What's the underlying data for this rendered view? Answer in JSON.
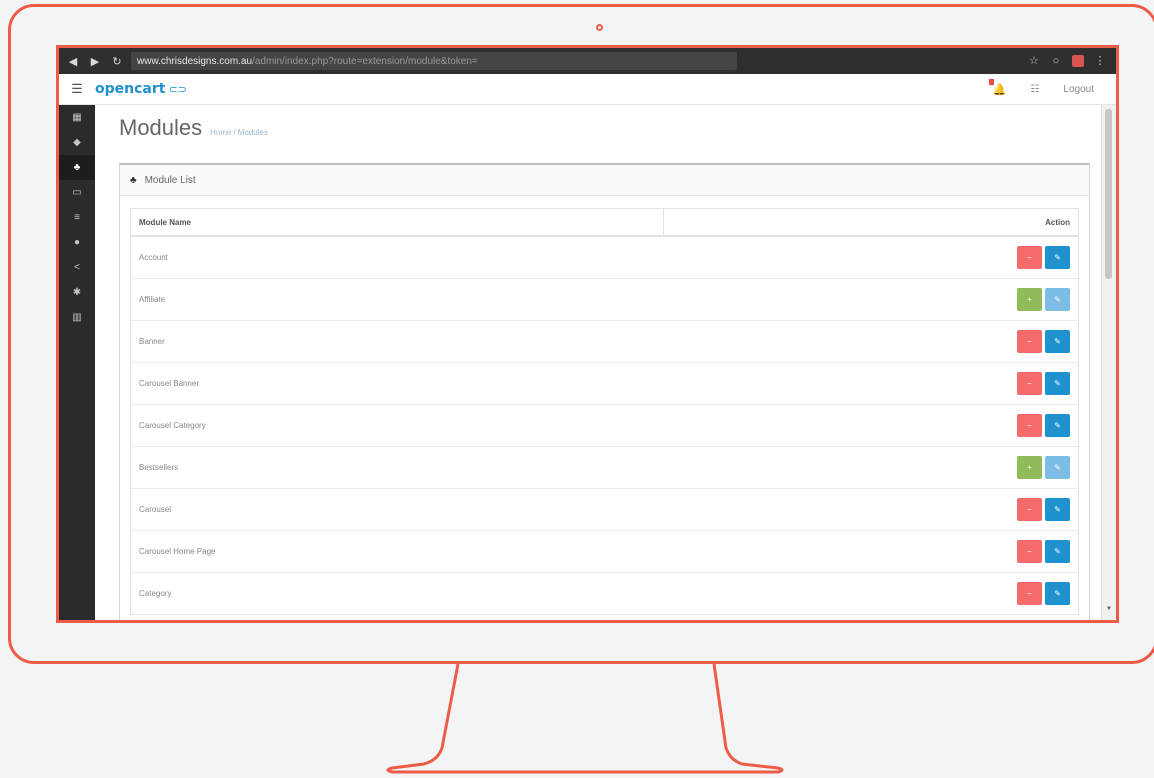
{
  "browser": {
    "url_host": "www.chrisdesigns.com.au",
    "url_path": "/admin/index.php?route=extension/module&token=",
    "icons": [
      "back-arrow-icon",
      "forward-arrow-icon",
      "reload-icon",
      "star-icon",
      "refresh-icon",
      "extension-icon",
      "menu-dots-icon"
    ]
  },
  "header": {
    "logo": "opencart",
    "logout_label": "Logout"
  },
  "sidebar": {
    "items": [
      {
        "icon": "dashboard-icon",
        "glyph": "▦",
        "active": false
      },
      {
        "icon": "catalog-icon",
        "glyph": "◆",
        "active": false
      },
      {
        "icon": "extensions-icon",
        "glyph": "♣",
        "active": true
      },
      {
        "icon": "design-icon",
        "glyph": "▭",
        "active": false
      },
      {
        "icon": "sales-icon",
        "glyph": "≡",
        "active": false
      },
      {
        "icon": "customers-icon",
        "glyph": "●",
        "active": false
      },
      {
        "icon": "marketing-icon",
        "glyph": "<",
        "active": false
      },
      {
        "icon": "system-icon",
        "glyph": "✱",
        "active": false
      },
      {
        "icon": "reports-icon",
        "glyph": "▥",
        "active": false
      }
    ]
  },
  "page": {
    "title": "Modules",
    "breadcrumb": [
      "Home",
      "Modules"
    ]
  },
  "panel": {
    "heading": "Module List",
    "columns": [
      "Module Name",
      "Action"
    ],
    "rows": [
      {
        "name": "Account",
        "installed": true
      },
      {
        "name": "Affiliate",
        "installed": false
      },
      {
        "name": "Banner",
        "installed": true
      },
      {
        "name": "Carousel Banner",
        "installed": true
      },
      {
        "name": "Carousel Category",
        "installed": true
      },
      {
        "name": "Bestsellers",
        "installed": false
      },
      {
        "name": "Carousel",
        "installed": true
      },
      {
        "name": "Carousel Home Page",
        "installed": true
      },
      {
        "name": "Category",
        "installed": true
      }
    ]
  },
  "colors": {
    "frame": "#ee5c48",
    "primary": "#1e91cf",
    "danger": "#f56b6b",
    "success": "#8fbb5a"
  }
}
